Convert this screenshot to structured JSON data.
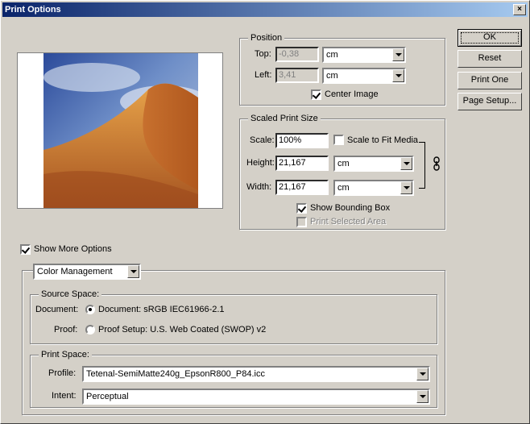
{
  "window": {
    "title": "Print Options",
    "close_glyph": "×"
  },
  "position": {
    "title": "Position",
    "top_label": "Top:",
    "top_value": "-0,38",
    "top_unit": "cm",
    "left_label": "Left:",
    "left_value": "3,41",
    "left_unit": "cm",
    "center_image_label": "Center Image",
    "center_image_checked": true
  },
  "scaled": {
    "title": "Scaled Print Size",
    "scale_label": "Scale:",
    "scale_value": "100%",
    "scale_to_fit_label": "Scale to Fit Media",
    "height_label": "Height:",
    "height_value": "21,167",
    "height_unit": "cm",
    "width_label": "Width:",
    "width_value": "21,167",
    "width_unit": "cm",
    "show_bounding_box_label": "Show Bounding Box",
    "print_selected_area_label": "Print Selected Area",
    "link_icon": "chain-link-icon"
  },
  "buttons": {
    "ok": "OK",
    "reset": "Reset",
    "print_one": "Print One",
    "page_setup": "Page Setup..."
  },
  "show_more_options": {
    "label": "Show More Options",
    "checked": true
  },
  "color_management": {
    "dropdown_value": "Color Management",
    "source_space": {
      "title": "Source Space:",
      "document_label": "Document:",
      "document_option": "Document:  sRGB IEC61966-2.1",
      "proof_label": "Proof:",
      "proof_option": "Proof Setup:  U.S. Web Coated (SWOP) v2"
    },
    "print_space": {
      "title": "Print Space:",
      "profile_label": "Profile:",
      "profile_value": "Tetenal-SemiMatte240g_EpsonR800_P84.icc",
      "intent_label": "Intent:",
      "intent_value": "Perceptual"
    }
  }
}
